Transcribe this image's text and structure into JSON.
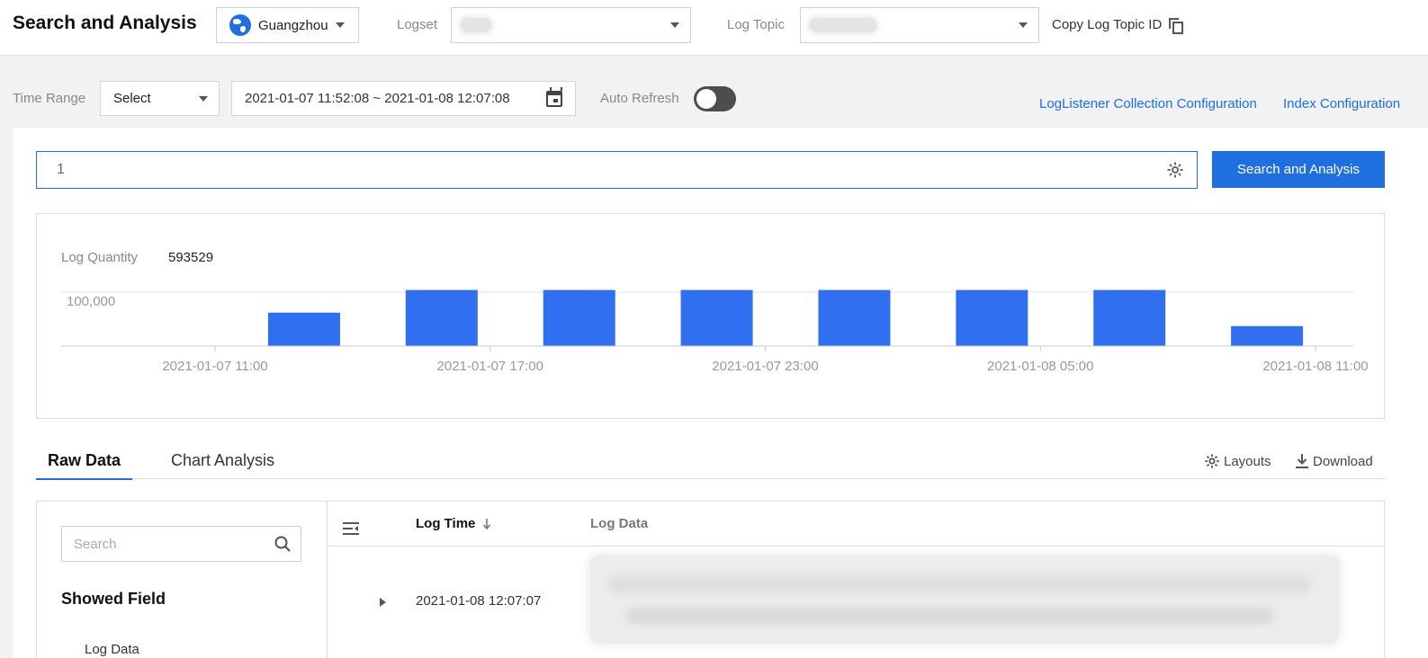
{
  "header": {
    "title": "Search and Analysis",
    "region": "Guangzhou",
    "logset_label": "Logset",
    "log_topic_label": "Log Topic",
    "copy_label": "Copy Log Topic ID"
  },
  "toolbar": {
    "time_range_label": "Time Range",
    "time_range_select": "Select",
    "date_range": "2021-01-07 11:52:08 ~ 2021-01-08 12:07:08",
    "auto_refresh_label": "Auto Refresh",
    "auto_refresh_on": false,
    "link_collection": "LogListener Collection Configuration",
    "link_index": "Index Configuration"
  },
  "search": {
    "query": "1",
    "button_label": "Search and Analysis"
  },
  "stats": {
    "log_quantity_label": "Log Quantity",
    "log_quantity_value": "593529"
  },
  "chart_data": {
    "type": "bar",
    "title": "",
    "xlabel": "",
    "ylabel": "",
    "ytick_label": "100,000",
    "ylim": [
      0,
      120000
    ],
    "x_ticks": [
      "2021-01-07 11:00",
      "2021-01-07 17:00",
      "2021-01-07 23:00",
      "2021-01-08 05:00",
      "2021-01-08 11:00"
    ],
    "bars": [
      {
        "start": "2021-01-07 09:00",
        "value": 0
      },
      {
        "start": "2021-01-07 12:00",
        "value": 62000
      },
      {
        "start": "2021-01-07 15:00",
        "value": 104000
      },
      {
        "start": "2021-01-07 18:00",
        "value": 104000
      },
      {
        "start": "2021-01-07 21:00",
        "value": 104000
      },
      {
        "start": "2021-01-08 00:00",
        "value": 104000
      },
      {
        "start": "2021-01-08 03:00",
        "value": 104000
      },
      {
        "start": "2021-01-08 06:00",
        "value": 104000
      },
      {
        "start": "2021-01-08 09:00",
        "value": 37000
      }
    ],
    "bar_color": "#2f6ff0",
    "grid": true
  },
  "tabs": [
    {
      "label": "Raw Data",
      "active": true
    },
    {
      "label": "Chart Analysis",
      "active": false
    }
  ],
  "tools": {
    "layouts": "Layouts",
    "download": "Download"
  },
  "sidebar": {
    "search_placeholder": "Search",
    "title": "Showed Field",
    "items": [
      "Log Data"
    ]
  },
  "table": {
    "col_time": "Log Time",
    "col_data": "Log Data",
    "rows": [
      {
        "time": "2021-01-08 12:07:07"
      }
    ]
  },
  "colors": {
    "accent": "#1f6fe0",
    "link": "#1a6fe8"
  }
}
